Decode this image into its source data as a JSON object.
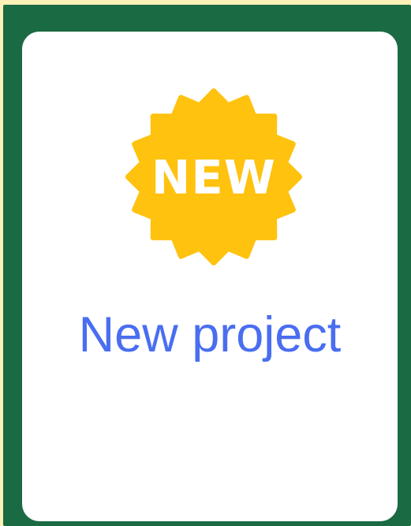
{
  "card": {
    "badge_text": "NEW",
    "label": "New project",
    "icon": "new-badge-icon"
  },
  "colors": {
    "background": "#fdf1b8",
    "frame": "#1a6a44",
    "card": "#ffffff",
    "badge": "#ffc20e",
    "label": "#4a6ef0"
  }
}
